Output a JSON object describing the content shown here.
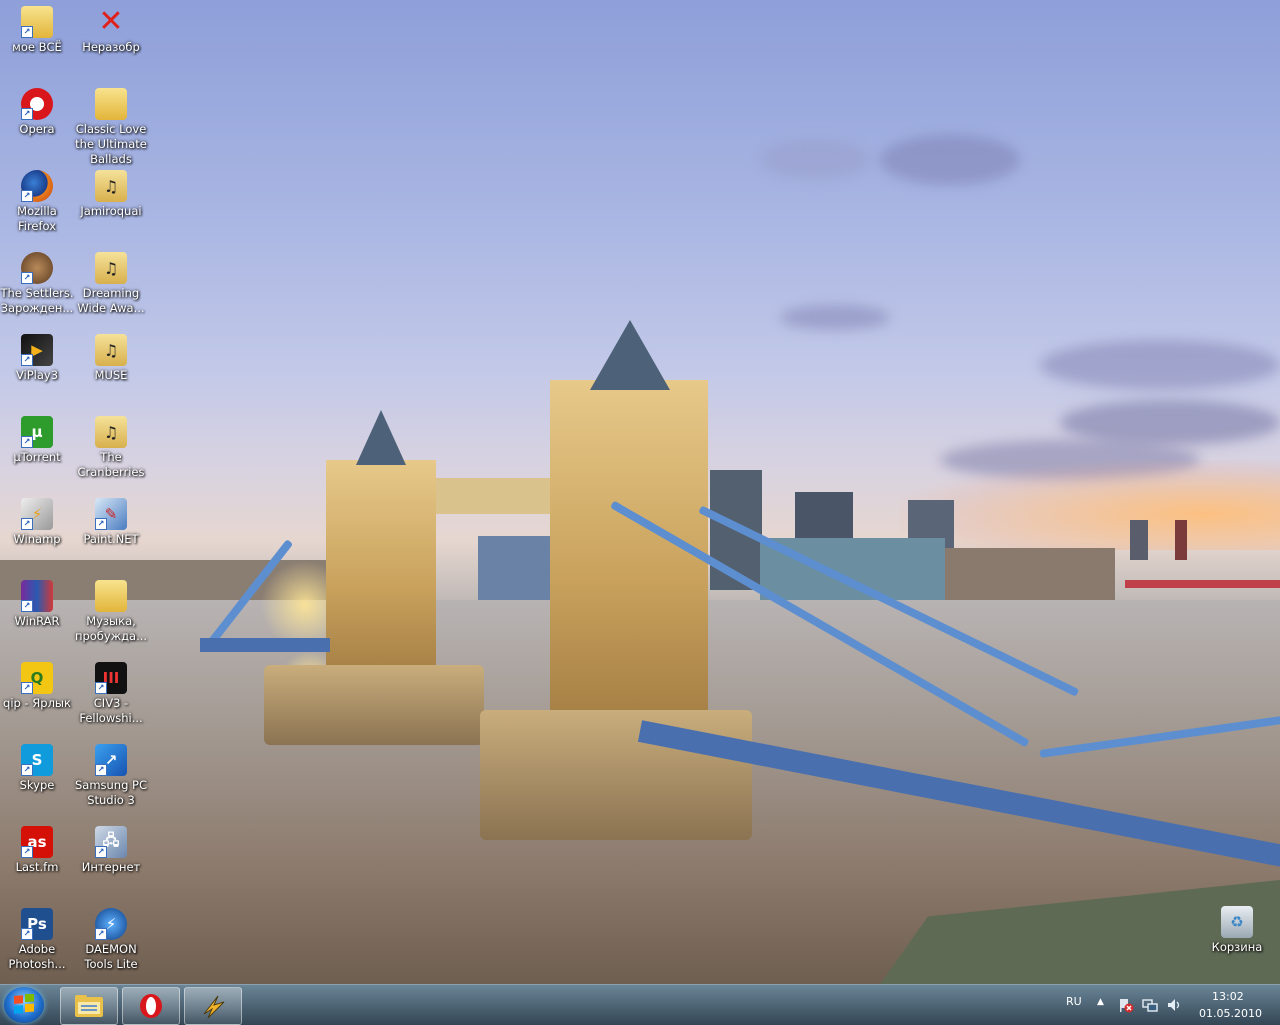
{
  "desktop": {
    "icons": [
      {
        "label": "мое ВСЁ",
        "icon": "folder-icon",
        "shortcut": true
      },
      {
        "label": "Неразобр",
        "icon": "red-x-icon",
        "shortcut": false
      },
      {
        "label": "Opera",
        "icon": "opera-icon",
        "shortcut": true
      },
      {
        "label": "Classic Love the Ultimate Ballads",
        "icon": "folder-icon",
        "shortcut": false
      },
      {
        "label": "Mozilla Firefox",
        "icon": "firefox-icon",
        "shortcut": true
      },
      {
        "label": "Jamiroquai",
        "icon": "music-folder-icon",
        "shortcut": false
      },
      {
        "label": "The Settlers. Зарожден...",
        "icon": "settlers-icon",
        "shortcut": true
      },
      {
        "label": "Dreaming Wide Awa...",
        "icon": "music-folder-icon",
        "shortcut": false
      },
      {
        "label": "ViPlay3",
        "icon": "viplay-icon",
        "shortcut": true
      },
      {
        "label": "MUSE",
        "icon": "music-folder-icon",
        "shortcut": false
      },
      {
        "label": "µTorrent",
        "icon": "utorrent-icon",
        "shortcut": true
      },
      {
        "label": "The Cranberries",
        "icon": "music-folder-icon",
        "shortcut": false
      },
      {
        "label": "Winamp",
        "icon": "winamp-icon",
        "shortcut": true
      },
      {
        "label": "Paint.NET",
        "icon": "paintnet-icon",
        "shortcut": true
      },
      {
        "label": "WinRAR",
        "icon": "winrar-icon",
        "shortcut": true
      },
      {
        "label": "Музыка, пробужда...",
        "icon": "folder-icon",
        "shortcut": false
      },
      {
        "label": "qip - Ярлык",
        "icon": "qip-icon",
        "shortcut": true
      },
      {
        "label": "CIV3 - Fellowshi...",
        "icon": "civ3-icon",
        "shortcut": true
      },
      {
        "label": "Skype",
        "icon": "skype-icon",
        "shortcut": true
      },
      {
        "label": "Samsung PC Studio 3",
        "icon": "samsung-icon",
        "shortcut": true
      },
      {
        "label": "Last.fm",
        "icon": "lastfm-icon",
        "shortcut": true
      },
      {
        "label": "Интернет",
        "icon": "internet-icon",
        "shortcut": true
      },
      {
        "label": "Adobe Photosh...",
        "icon": "photoshop-icon",
        "shortcut": true
      },
      {
        "label": "DAEMON Tools Lite",
        "icon": "daemon-tools-icon",
        "shortcut": true
      },
      {
        "label": "Корзина",
        "icon": "recycle-bin-icon",
        "shortcut": false
      }
    ]
  },
  "taskbar": {
    "pinned": [
      "explorer-icon",
      "opera-icon",
      "winamp-icon"
    ],
    "tray": {
      "language": "RU",
      "time": "13:02",
      "date": "01.05.2010",
      "icons": [
        "show-hidden-icons-arrow",
        "flag-error-icon",
        "network-icon",
        "volume-icon"
      ]
    }
  }
}
